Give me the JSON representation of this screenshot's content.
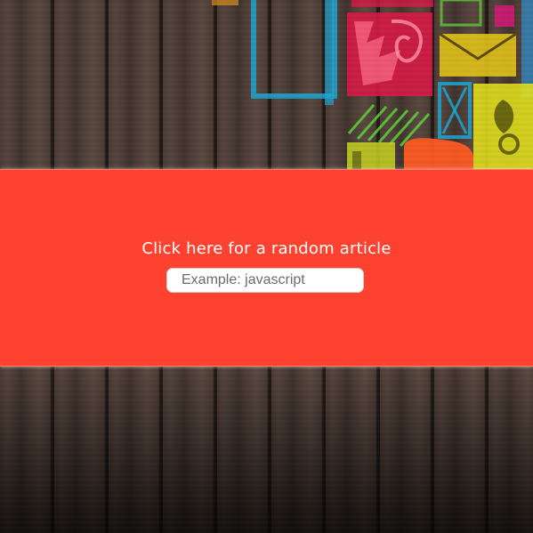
{
  "page": {
    "random_article_label": "Click here for a random article",
    "search_placeholder": "Example: javascript",
    "search_value": ""
  },
  "colors": {
    "banner": "#ff4130",
    "link_text": "#ffffff",
    "wood": "#473832"
  },
  "icons": [
    "wood-plank-background",
    "graffiti-mural"
  ]
}
